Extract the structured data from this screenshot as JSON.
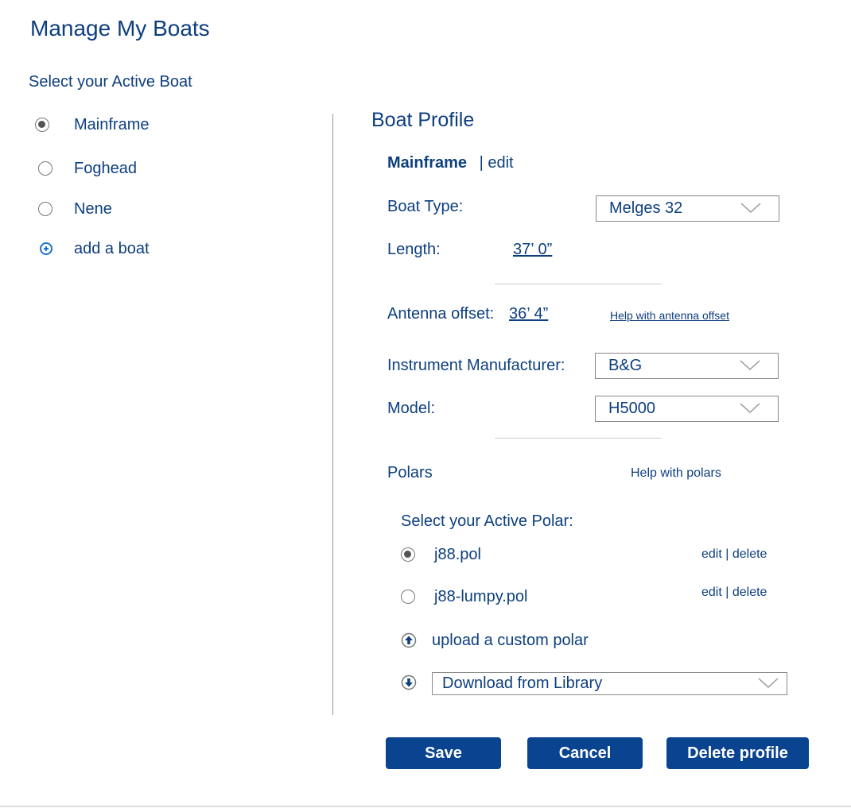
{
  "page_title": "Manage My Boats",
  "boats_section": {
    "label": "Select your Active Boat",
    "items": [
      {
        "label": "Mainframe",
        "selected": true
      },
      {
        "label": "Foghead",
        "selected": false
      },
      {
        "label": "Nene",
        "selected": false
      }
    ],
    "add_label": "add a boat"
  },
  "profile": {
    "title": "Boat Profile",
    "boat_name": "Mainframe",
    "edit_sep": "|",
    "edit_label": "edit",
    "boat_type_label": "Boat Type:",
    "boat_type_value": "Melges 32",
    "length_label": "Length:",
    "length_value": "37’ 0”",
    "antenna_label": "Antenna offset:",
    "antenna_value": "36’ 4”",
    "antenna_help": "Help with antenna offset",
    "manufacturer_label": "Instrument Manufacturer:",
    "manufacturer_value": "B&G",
    "model_label": "Model:",
    "model_value": "H5000",
    "polars_label": "Polars",
    "polars_help": "Help with polars",
    "active_polar_label": "Select your Active Polar:",
    "polars": [
      {
        "name": "j88.pol",
        "selected": true,
        "edit": "edit",
        "sep": "|",
        "delete": "delete"
      },
      {
        "name": "j88-lumpy.pol",
        "selected": false,
        "edit": "edit",
        "sep": "|",
        "delete": "delete"
      }
    ],
    "upload_label": "upload a custom polar",
    "download_value": "Download from Library"
  },
  "buttons": {
    "save": "Save",
    "cancel": "Cancel",
    "delete": "Delete profile"
  },
  "colors": {
    "text_primary": "#0d3f7f",
    "button_bg": "#0a438f",
    "accent_blue": "#1a73d4"
  }
}
